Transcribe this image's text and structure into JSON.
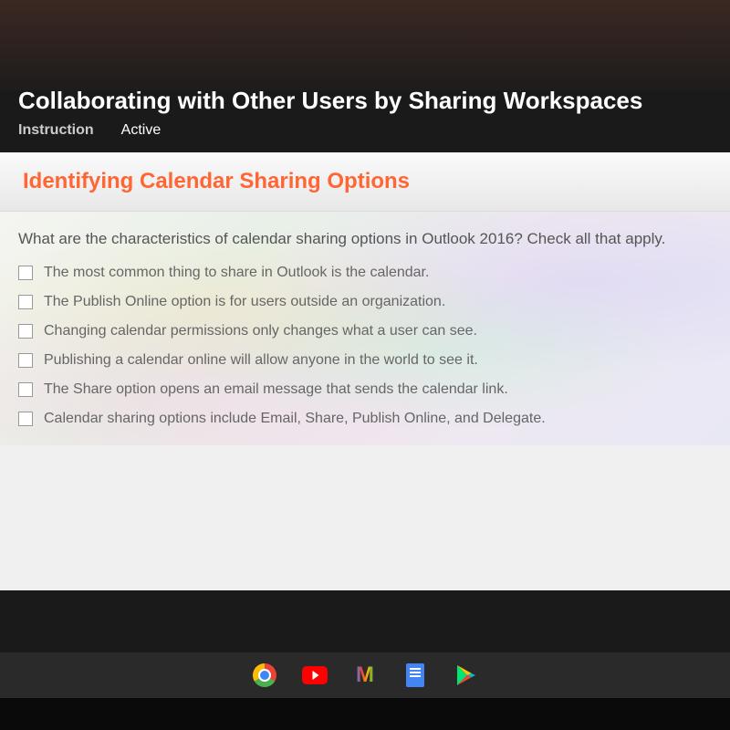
{
  "header": {
    "main_title": "Collaborating with Other Users by Sharing Workspaces",
    "tab_instruction": "Instruction",
    "tab_active": "Active"
  },
  "content": {
    "section_title": "Identifying Calendar Sharing Options",
    "question": "What are the characteristics of calendar sharing options in Outlook 2016? Check all that apply.",
    "options": [
      "The most common thing to share in Outlook is the calendar.",
      "The Publish Online option is for users outside an organization.",
      "Changing calendar permissions only changes what a user can see.",
      "Publishing a calendar online will allow anyone in the world to see it.",
      "The Share option opens an email message that sends the calendar link.",
      "Calendar sharing options include Email, Share, Publish Online, and Delegate."
    ]
  },
  "taskbar": {
    "icons": [
      "chrome",
      "youtube",
      "gmail",
      "docs",
      "play"
    ]
  }
}
